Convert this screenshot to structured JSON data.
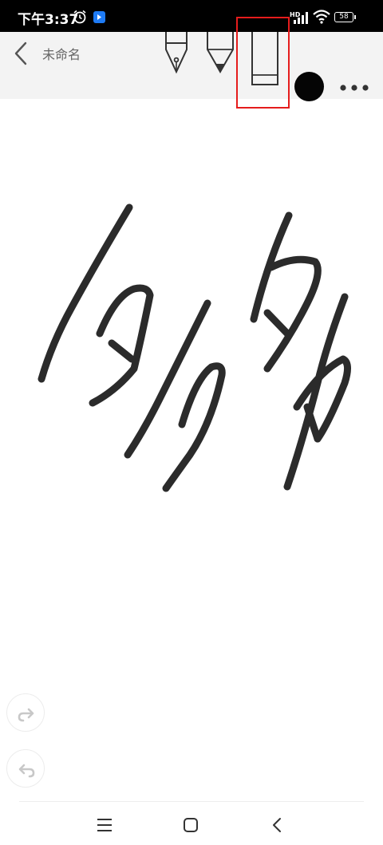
{
  "status_bar": {
    "time": "下午3:37",
    "network": "HD",
    "battery": "58"
  },
  "toolbar": {
    "title": "未命名",
    "tools": [
      "fountain-pen",
      "marker-pen",
      "eraser"
    ],
    "selected_tool": "eraser",
    "current_color": "#050505"
  },
  "canvas": {
    "stroke_color": "#2b2b2b"
  },
  "controls": [
    "redo",
    "undo"
  ],
  "nav": [
    "menu",
    "home",
    "back"
  ]
}
